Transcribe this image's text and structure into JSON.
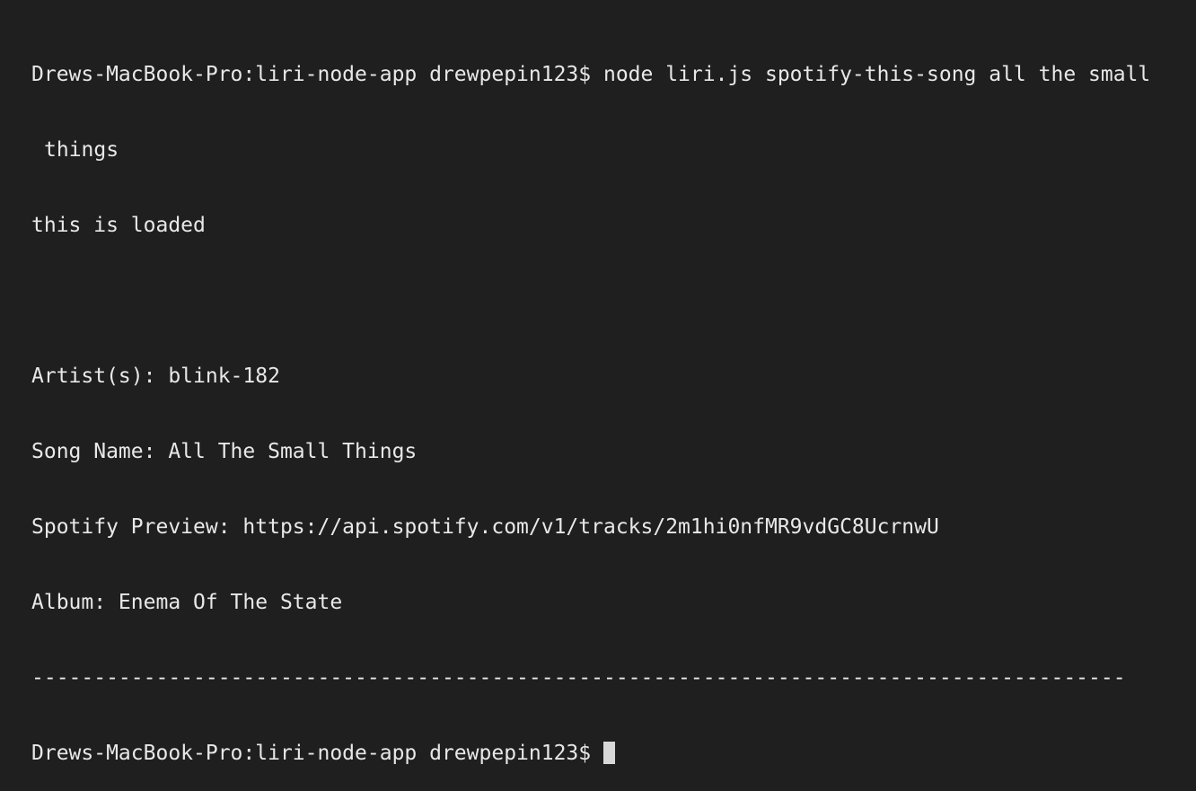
{
  "terminal": {
    "command_line_part1": "Drews-MacBook-Pro:liri-node-app drewpepin123$ node liri.js spotify-this-song all the small",
    "command_line_part2": "things",
    "loaded_message": "this is loaded",
    "artist": "Artist(s): blink-182",
    "song_name": "Song Name: All The Small Things",
    "spotify_preview": "Spotify Preview: https://api.spotify.com/v1/tracks/2m1hi0nfMR9vdGC8UcrnwU",
    "album": "Album: Enema Of The State",
    "divider": "----------------------------------------------------------------------------------------",
    "prompt": "Drews-MacBook-Pro:liri-node-app drewpepin123$"
  },
  "colors": {
    "background": "#1f1f1f",
    "text": "#e8e8e8",
    "cursor": "#d8d8d8"
  }
}
